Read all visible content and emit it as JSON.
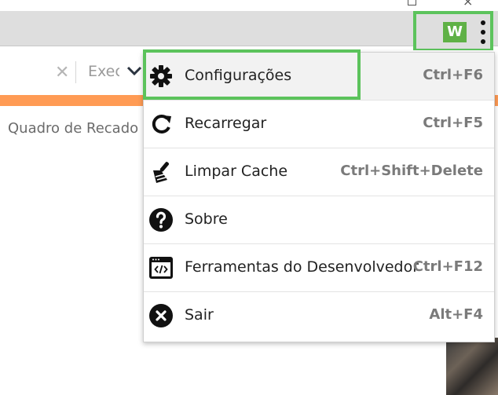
{
  "toolbar": {
    "logo_letter": "W",
    "menu_icon": "kebab-menu-icon"
  },
  "page": {
    "search_clear_icon": "close-icon",
    "exec_label": "Exec",
    "dropdown_icon": "chevron-down-icon",
    "board_title": "Quadro de Recado"
  },
  "menu": {
    "items": [
      {
        "label": "Configurações",
        "shortcut": "Ctrl+F6",
        "icon": "gear-icon"
      },
      {
        "label": "Recarregar",
        "shortcut": "Ctrl+F5",
        "icon": "reload-icon"
      },
      {
        "label": "Limpar Cache",
        "shortcut": "Ctrl+Shift+Delete",
        "icon": "broom-icon"
      },
      {
        "label": "Sobre",
        "shortcut": "",
        "icon": "help-icon"
      },
      {
        "label": "Ferramentas do Desenvolvedor",
        "shortcut": "Ctrl+F12",
        "icon": "devtools-icon"
      },
      {
        "label": "Sair",
        "shortcut": "Alt+F4",
        "icon": "exit-icon"
      }
    ]
  },
  "colors": {
    "highlight": "#5cc35c",
    "accent_bar": "#ff9b54",
    "logo_bg": "#5fb146"
  }
}
